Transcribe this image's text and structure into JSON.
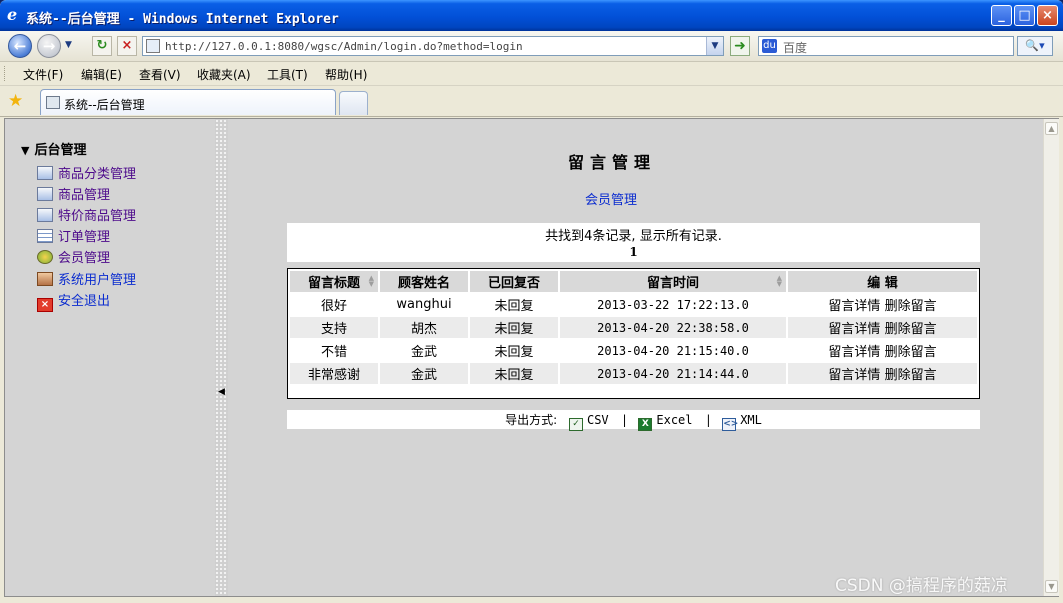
{
  "window": {
    "title": "系统--后台管理 - Windows Internet Explorer",
    "min": "_",
    "max": "□",
    "close": "×"
  },
  "nav": {
    "back": "←",
    "forward": "→",
    "refresh": "↻",
    "stop": "×",
    "address": "http://127.0.0.1:8080/wgsc/Admin/login.do?method=login",
    "go": "➜",
    "search_placeholder": "百度",
    "search_btn": "🔍▾"
  },
  "menu": [
    "文件(F)",
    "编辑(E)",
    "查看(V)",
    "收藏夹(A)",
    "工具(T)",
    "帮助(H)"
  ],
  "tab": {
    "title": "系统--后台管理"
  },
  "sidebar": {
    "root": "后台管理",
    "items": [
      {
        "label": "商品分类管理",
        "icon": "category-icon"
      },
      {
        "label": "商品管理",
        "icon": "product-icon"
      },
      {
        "label": "特价商品管理",
        "icon": "special-product-icon"
      },
      {
        "label": "订单管理",
        "icon": "orders-icon"
      },
      {
        "label": "会员管理",
        "icon": "member-icon"
      },
      {
        "label": "系统用户管理",
        "icon": "user-icon"
      },
      {
        "label": "安全退出",
        "icon": "exit-icon"
      }
    ]
  },
  "main": {
    "title": "留言管理",
    "member_link": "会员管理",
    "summary": "共找到4条记录, 显示所有记录.",
    "page": "1",
    "columns": [
      "留言标题",
      "顾客姓名",
      "已回复否",
      "留言时间",
      "编 辑"
    ],
    "rows": [
      {
        "title": "很好",
        "name": "wanghui",
        "replied": "未回复",
        "time": "2013-03-22 17:22:13.0",
        "detail": "留言详情",
        "delete": "删除留言"
      },
      {
        "title": "支持",
        "name": "胡杰",
        "replied": "未回复",
        "time": "2013-04-20 22:38:58.0",
        "detail": "留言详情",
        "delete": "删除留言"
      },
      {
        "title": "不错",
        "name": "金武",
        "replied": "未回复",
        "time": "2013-04-20 21:15:40.0",
        "detail": "留言详情",
        "delete": "删除留言"
      },
      {
        "title": "非常感谢",
        "name": "金武",
        "replied": "未回复",
        "time": "2013-04-20 21:14:44.0",
        "detail": "留言详情",
        "delete": "删除留言"
      }
    ],
    "export": {
      "label": "导出方式:",
      "csv": "CSV",
      "excel": "Excel",
      "xml": "XML",
      "sep": "|"
    }
  },
  "watermark": "CSDN @搞程序的菇凉"
}
